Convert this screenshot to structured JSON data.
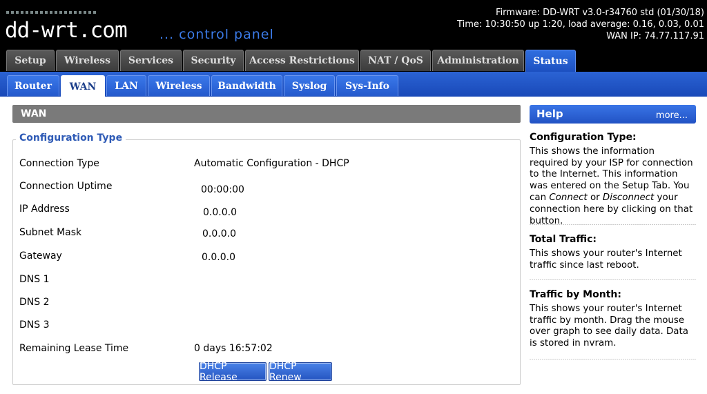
{
  "header": {
    "logo": "dd-wrt.com",
    "tagline": "... control panel",
    "firmware": "Firmware: DD-WRT v3.0-r34760 std (01/30/18)",
    "time": "Time: 10:30:50 up 1:20, load average: 0.16, 0.03, 0.01",
    "wan_ip": "WAN IP: 74.77.117.91"
  },
  "main_tabs": [
    "Setup",
    "Wireless",
    "Services",
    "Security",
    "Access Restrictions",
    "NAT / QoS",
    "Administration",
    "Status"
  ],
  "sub_tabs": [
    "Router",
    "WAN",
    "LAN",
    "Wireless",
    "Bandwidth",
    "Syslog",
    "Sys-Info"
  ],
  "section_title": "WAN",
  "config": {
    "legend": "Configuration Type",
    "rows": [
      {
        "label": "Connection Type",
        "value": "Automatic Configuration - DHCP"
      },
      {
        "label": "Connection Uptime",
        "value": "00:00:00"
      },
      {
        "label": "IP Address",
        "value": "0.0.0.0"
      },
      {
        "label": "Subnet Mask",
        "value": "0.0.0.0"
      },
      {
        "label": "Gateway",
        "value": "0.0.0.0"
      },
      {
        "label": "DNS 1",
        "value": ""
      },
      {
        "label": "DNS 2",
        "value": ""
      },
      {
        "label": "DNS 3",
        "value": ""
      },
      {
        "label": "Remaining Lease Time",
        "value": "0 days 16:57:02"
      }
    ],
    "release_label": "DHCP Release",
    "renew_label": "DHCP Renew"
  },
  "help": {
    "title": "Help",
    "more": "more...",
    "sections": [
      {
        "title": "Configuration Type:",
        "parts": [
          {
            "t": "This shows the information required by your ISP for connection to the Internet. This information was entered on the Setup Tab. You can "
          },
          {
            "t": "Connect",
            "i": true
          },
          {
            "t": " or "
          },
          {
            "t": "Disconnect",
            "i": true
          },
          {
            "t": " your connection here by clicking on that button."
          }
        ]
      },
      {
        "title": "Total Traffic:",
        "parts": [
          {
            "t": "This shows your router's Internet traffic since last reboot."
          }
        ]
      },
      {
        "title": "Traffic by Month:",
        "parts": [
          {
            "t": "This shows your router's Internet traffic by month. Drag the mouse over graph to see daily data. Data is stored in nvram."
          }
        ]
      }
    ]
  },
  "colors": {
    "accent": "#2459cc",
    "header_bg": "#000000"
  }
}
